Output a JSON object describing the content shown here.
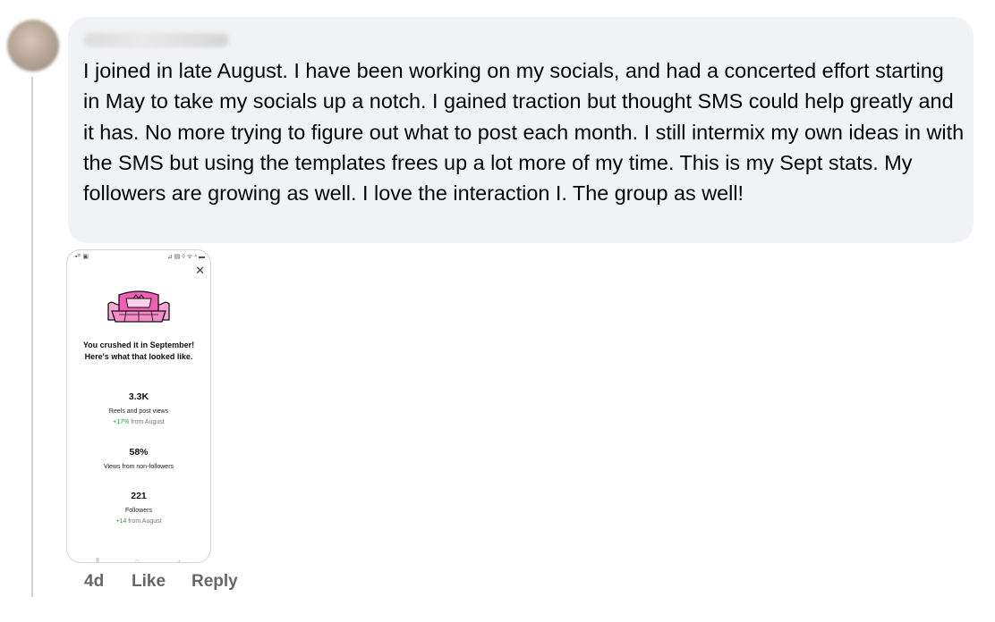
{
  "comment": {
    "text": "I joined in late August. I have been working on my socials, and had a concerted effort starting in May to take my socials up a notch. I gained traction but thought SMS could help greatly and it has. No more trying to figure out what to post each month. I still intermix my own ideas in with the SMS but using the templates frees up a lot more of my time. This is my Sept stats. My followers are growing as well. I love the interaction I. The group as well!",
    "time": "4d",
    "like_label": "Like",
    "reply_label": "Reply"
  },
  "screenshot": {
    "status_left": "▪ᴵ⁰ ▣",
    "status_right": "⊿ ▤ ◊ ᯤ ⁴ ▬",
    "headline": "You crushed it in September! Here's what that looked like.",
    "stats": [
      {
        "value": "3.3K",
        "label": "Reels and post views",
        "change_value": "+17%",
        "change_suffix": " from August"
      },
      {
        "value": "58%",
        "label": "Views from non-followers"
      },
      {
        "value": "221",
        "label": "Followers",
        "change_value": "+14",
        "change_suffix": " from August"
      }
    ]
  },
  "icons": {
    "close": "close-icon",
    "illustration": "stage-illustration-icon",
    "nav_recents": "nav-recents-icon",
    "nav_home": "nav-home-icon",
    "nav_back": "nav-back-icon"
  },
  "colors": {
    "bubble": "#f0f2f5",
    "text": "#050505",
    "muted": "#65676b",
    "accent_pink": "#ef5fb4",
    "positive": "#1b9e3e"
  }
}
